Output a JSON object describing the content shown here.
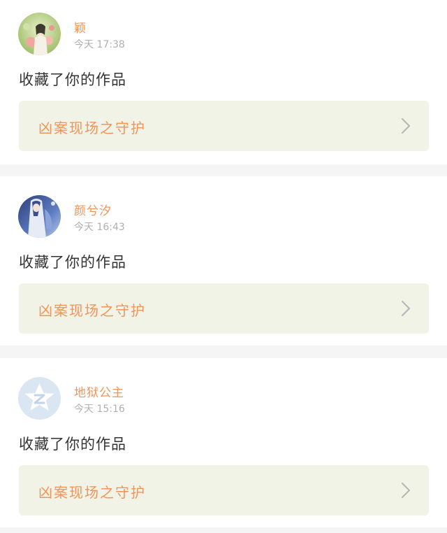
{
  "notifications": [
    {
      "username": "颖",
      "timestamp": "今天 17:38",
      "action": "收藏了你的作品",
      "work_title": "凶案现场之守护",
      "avatar_icon": "girl-with-flowers-avatar"
    },
    {
      "username": "颜兮汐",
      "timestamp": "今天 16:43",
      "action": "收藏了你的作品",
      "work_title": "凶案现场之守护",
      "avatar_icon": "anime-figure-avatar"
    },
    {
      "username": "地狱公主",
      "timestamp": "今天 15:16",
      "action": "收藏了你的作品",
      "work_title": "凶案现场之守护",
      "avatar_icon": "default-star-avatar"
    }
  ],
  "colors": {
    "accent": "#f0945a",
    "card_link_bg": "#f1f3e6",
    "timestamp": "#b0b0b0",
    "separator": "#f5f5f5"
  }
}
